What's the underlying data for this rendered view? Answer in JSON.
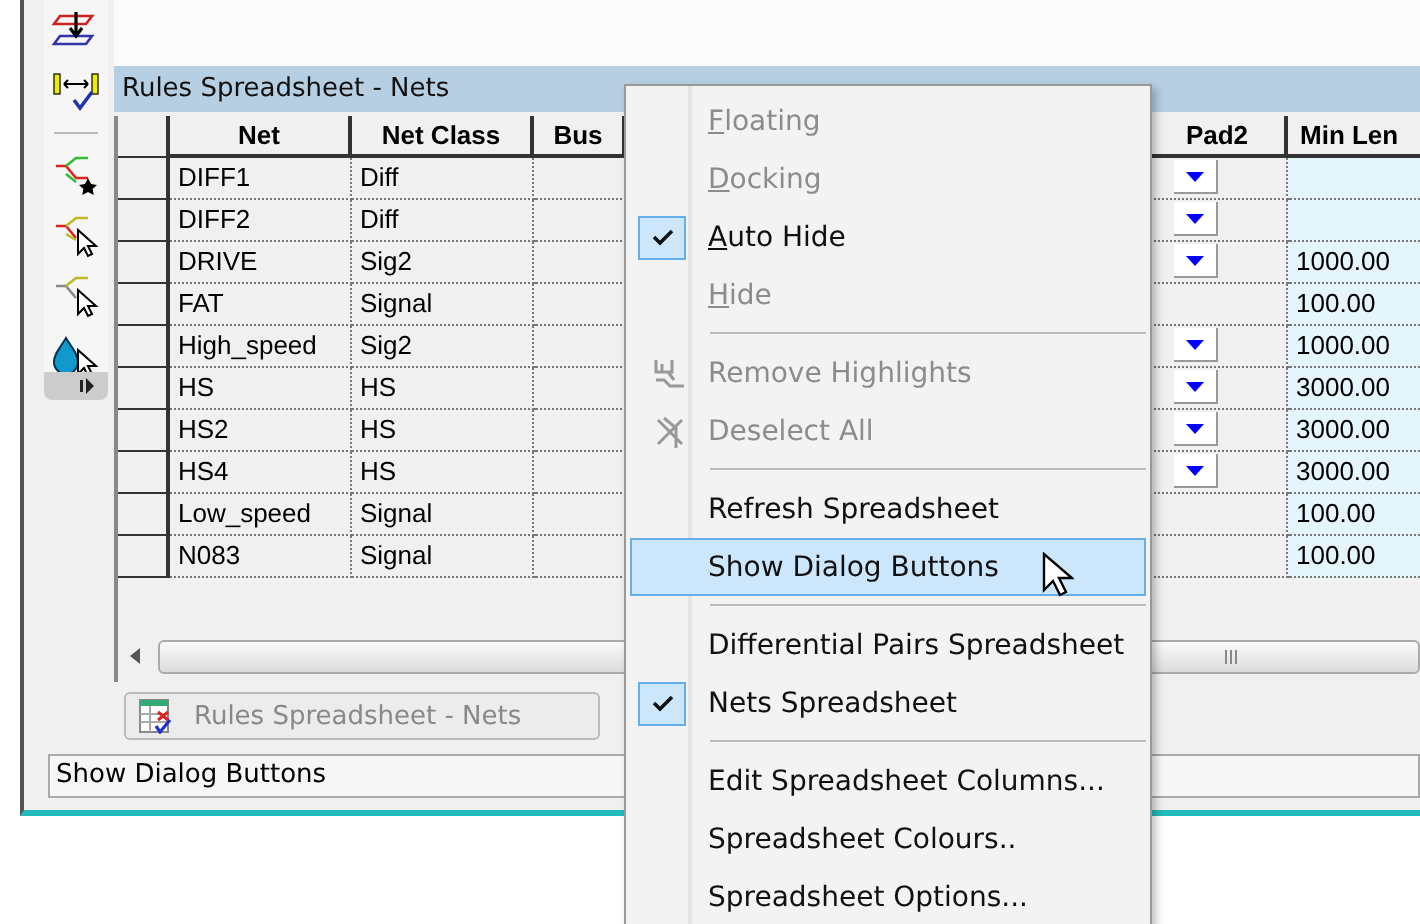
{
  "panel": {
    "title": "Rules Spreadsheet - Nets"
  },
  "table": {
    "columns_left": [
      "Net",
      "Net Class",
      "Bus"
    ],
    "columns_right": [
      "Pad2",
      "Min Len"
    ],
    "rows": [
      {
        "net": "DIFF1",
        "net_class": "Diff",
        "pad2_dropdown": true
      },
      {
        "net": "DIFF2",
        "net_class": "Diff",
        "pad2_dropdown": true
      },
      {
        "net": "DRIVE",
        "net_class": "Sig2",
        "pad2_dropdown": true,
        "min_len": "1000.00"
      },
      {
        "net": "FAT",
        "net_class": "Signal",
        "pad2_dropdown": false,
        "min_len": "100.00"
      },
      {
        "net": "High_speed",
        "net_class": "Sig2",
        "pad2_dropdown": true,
        "min_len": "1000.00"
      },
      {
        "net": "HS",
        "net_class": "HS",
        "pad2_dropdown": true,
        "min_len": "3000.00"
      },
      {
        "net": "HS2",
        "net_class": "HS",
        "pad2_dropdown": true,
        "min_len": "3000.00"
      },
      {
        "net": "HS4",
        "net_class": "HS",
        "pad2_dropdown": true,
        "min_len": "3000.00"
      },
      {
        "net": "Low_speed",
        "net_class": "Signal",
        "pad2_dropdown": false,
        "min_len": "100.00"
      },
      {
        "net": "N083",
        "net_class": "Signal",
        "pad2_dropdown": false,
        "min_len": "100.00"
      }
    ]
  },
  "document_tab": {
    "label": "Rules Spreadsheet - Nets"
  },
  "status_bar": {
    "text": "Show Dialog Buttons"
  },
  "context_menu": {
    "items": [
      {
        "kind": "item",
        "label": "Floating",
        "disabled": true,
        "checked": false,
        "selected": false,
        "underline_first": true
      },
      {
        "kind": "item",
        "label": "Docking",
        "disabled": true,
        "checked": false,
        "selected": false,
        "underline_first": true
      },
      {
        "kind": "item",
        "label": "Auto Hide",
        "disabled": false,
        "checked": true,
        "selected": false,
        "underline_first": true
      },
      {
        "kind": "item",
        "label": "Hide",
        "disabled": true,
        "checked": false,
        "selected": false,
        "underline_first": true
      },
      {
        "kind": "separator"
      },
      {
        "kind": "linkicon",
        "label": "Remove Highlights",
        "disabled": true,
        "checked": false,
        "selected": false,
        "underline_first": false
      },
      {
        "kind": "crossicon",
        "label": "Deselect All",
        "disabled": true,
        "checked": false,
        "selected": false,
        "underline_first": false
      },
      {
        "kind": "separator"
      },
      {
        "kind": "item",
        "label": "Refresh Spreadsheet",
        "disabled": false,
        "checked": false,
        "selected": false,
        "underline_first": false
      },
      {
        "kind": "item",
        "label": "Show Dialog Buttons",
        "disabled": false,
        "checked": false,
        "selected": true,
        "underline_first": false
      },
      {
        "kind": "separator"
      },
      {
        "kind": "item",
        "label": "Differential Pairs Spreadsheet",
        "disabled": false,
        "checked": false,
        "selected": false,
        "underline_first": false
      },
      {
        "kind": "item",
        "label": "Nets Spreadsheet",
        "disabled": false,
        "checked": true,
        "selected": false,
        "underline_first": false
      },
      {
        "kind": "separator"
      },
      {
        "kind": "item",
        "label": "Edit Spreadsheet Columns...",
        "disabled": false,
        "checked": false,
        "selected": false,
        "underline_first": false
      },
      {
        "kind": "item",
        "label": "Spreadsheet Colours..",
        "disabled": false,
        "checked": false,
        "selected": false,
        "underline_first": false
      },
      {
        "kind": "item",
        "label": "Spreadsheet Options...",
        "disabled": false,
        "checked": false,
        "selected": false,
        "underline_first": false
      }
    ]
  }
}
